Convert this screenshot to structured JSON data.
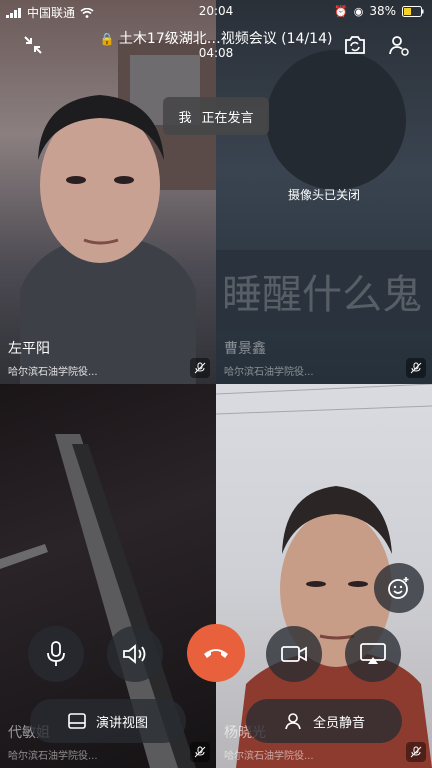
{
  "status_bar": {
    "carrier": "中国联通",
    "time": "20:04",
    "battery": "38%"
  },
  "header": {
    "title": "土木17级湖北…视频会议 (14/14)",
    "duration": "04:08"
  },
  "speaking_banner": {
    "who": "我",
    "text": "正在发言"
  },
  "participants": [
    {
      "name": "左平阳",
      "org": "哈尔滨石油学院役..."
    },
    {
      "name": "曹景鑫",
      "org": "哈尔滨石油学院役...",
      "camera_off_text": "摄像头已关闭",
      "bg_text": "睡醒什么鬼"
    },
    {
      "name": "代敏姐",
      "org": "哈尔滨石油学院役..."
    },
    {
      "name": "杨晓光",
      "org": "哈尔滨石油学院役..."
    }
  ],
  "controls": {
    "presentation_view": "演讲视图",
    "mute_all": "全员静音"
  },
  "colors": {
    "hangup": "#e8613c",
    "control_bg": "#2b2f35"
  }
}
